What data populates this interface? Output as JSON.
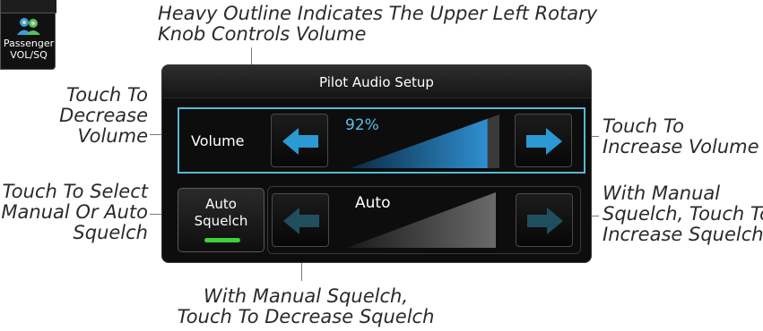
{
  "corner_button": {
    "label_line1": "Passenger",
    "label_line2": "VOL/SQ",
    "icon": "passenger-icon"
  },
  "panel": {
    "title": "Pilot Audio Setup",
    "volume": {
      "label": "Volume",
      "value_text": "92%",
      "level": 0.92
    },
    "squelch": {
      "button_line1": "Auto",
      "button_line2": "Squelch",
      "mode_text": "Auto",
      "active": true
    }
  },
  "callouts": {
    "top_line1": "Heavy Outline Indicates The Upper Left Rotary",
    "top_line2": "Knob Controls Volume",
    "decrease_volume": [
      "Touch To",
      "Decrease",
      "Volume"
    ],
    "increase_volume": [
      "Touch To",
      "Increase Volume"
    ],
    "select_squelch": [
      "Touch To Select",
      "Manual Or Auto",
      "Squelch"
    ],
    "increase_squelch": [
      "With Manual",
      "Squelch, Touch To",
      "Increase Squelch"
    ],
    "decrease_squelch_line1": "With Manual Squelch,",
    "decrease_squelch_line2": "Touch To Decrease Squelch"
  },
  "colors": {
    "outline": "#56b9d6",
    "arrow_active": "#2b9ad4",
    "arrow_dim": "#1f4f5e",
    "squelch_on": "#3ed23a"
  }
}
